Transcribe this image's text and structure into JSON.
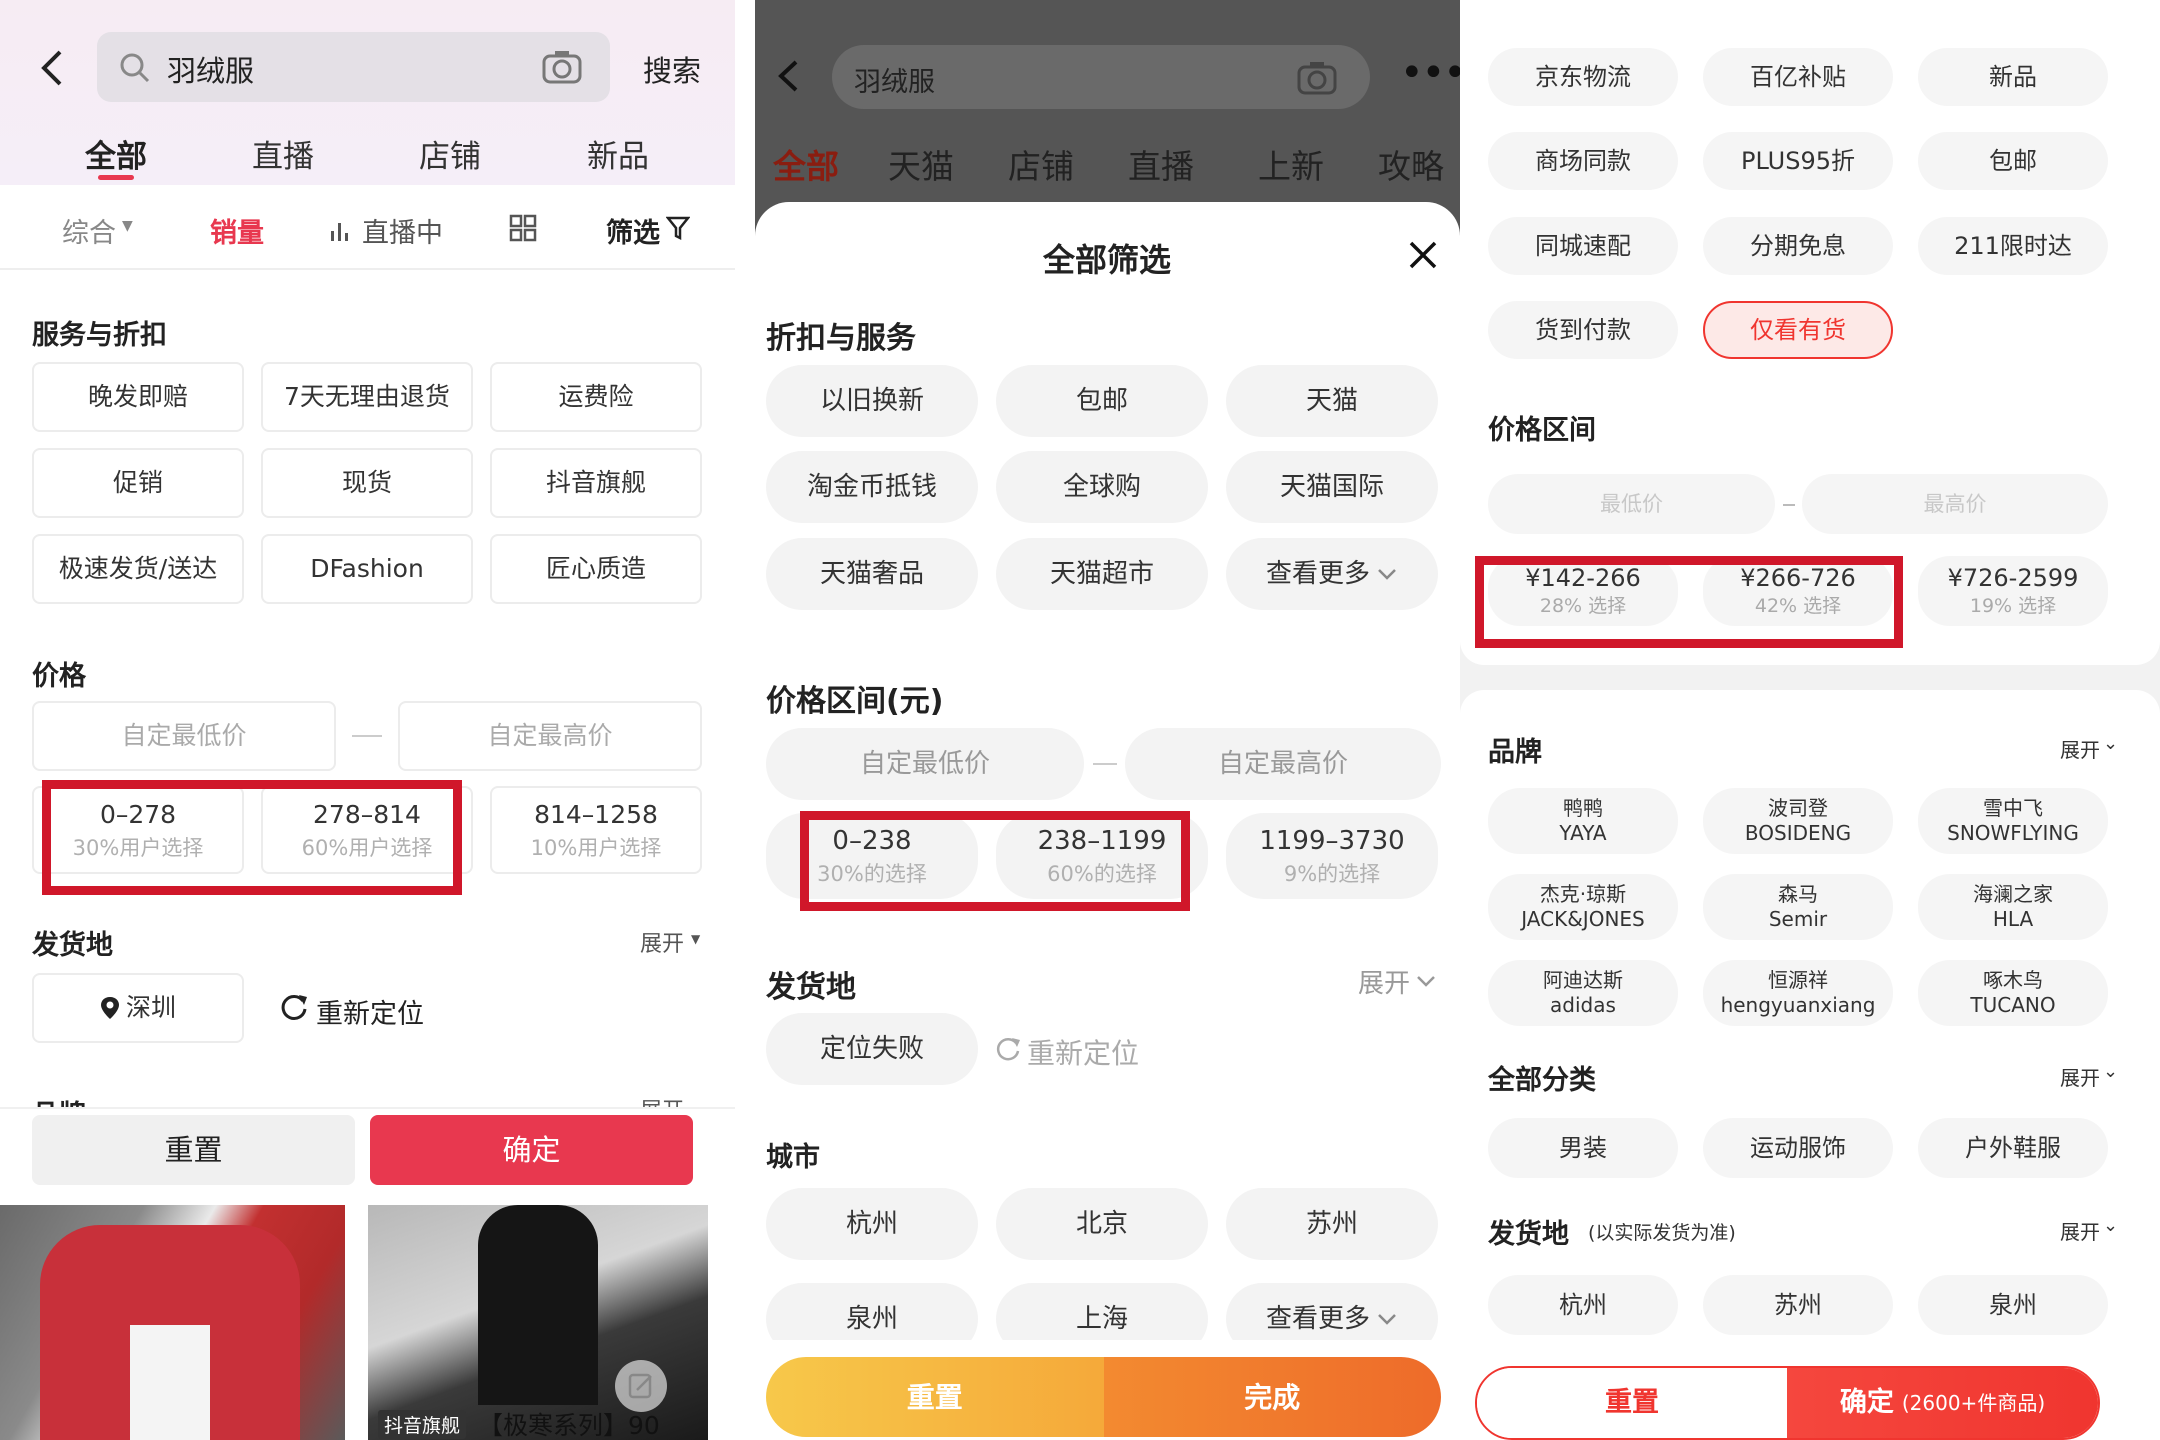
{
  "p1": {
    "search_value": "羽绒服",
    "search_button": "搜索",
    "tabs": [
      "全部",
      "直播",
      "店铺",
      "新品"
    ],
    "sort": {
      "comprehensive": "综合",
      "sales": "销量",
      "live": "直播中",
      "filter": "筛选"
    },
    "service_title": "服务与折扣",
    "service_chips": [
      "晚发即赔",
      "7天无理由退货",
      "运费险",
      "促销",
      "现货",
      "抖音旗舰",
      "极速发货/送达",
      "DFashion",
      "匠心质造"
    ],
    "price_title": "价格",
    "min_placeholder": "自定最低价",
    "max_placeholder": "自定最高价",
    "ranges": [
      {
        "range": "0–278",
        "pct": "30%用户选择"
      },
      {
        "range": "278–814",
        "pct": "60%用户选择"
      },
      {
        "range": "814–1258",
        "pct": "10%用户选择"
      }
    ],
    "ship_title": "发货地",
    "expand": "展开",
    "location": "深圳",
    "relocate": "重新定位",
    "brand_title": "品牌",
    "reset": "重置",
    "confirm": "确定",
    "product_tag": "抖音旗舰",
    "product_title": "【极寒系列】90"
  },
  "p2": {
    "search_value": "羽绒服",
    "tabs": [
      "全部",
      "天猫",
      "店铺",
      "直播",
      "上新",
      "攻略"
    ],
    "sheet_title": "全部筛选",
    "service_title": "折扣与服务",
    "service_chips": [
      "以旧换新",
      "包邮",
      "天猫",
      "淘金币抵钱",
      "全球购",
      "天猫国际",
      "天猫奢品",
      "天猫超市",
      "查看更多"
    ],
    "price_title": "价格区间(元)",
    "min_placeholder": "自定最低价",
    "max_placeholder": "自定最高价",
    "ranges": [
      {
        "range": "0–238",
        "pct": "30%的选择"
      },
      {
        "range": "238–1199",
        "pct": "60%的选择"
      },
      {
        "range": "1199–3730",
        "pct": "9%的选择"
      }
    ],
    "ship_title": "发货地",
    "expand": "展开",
    "location_failed": "定位失败",
    "relocate": "重新定位",
    "city_title": "城市",
    "cities": [
      "杭州",
      "北京",
      "苏州",
      "泉州",
      "上海",
      "查看更多"
    ],
    "reset": "重置",
    "done": "完成"
  },
  "p3": {
    "service_chips": [
      "京东物流",
      "百亿补贴",
      "新品",
      "商场同款",
      "PLUS95折",
      "包邮",
      "同城速配",
      "分期免息",
      "211限时达",
      "货到付款",
      "仅看有货"
    ],
    "price_title": "价格区间",
    "min_placeholder": "最低价",
    "max_placeholder": "最高价",
    "ranges": [
      {
        "range": "¥142-266",
        "pct": "28% 选择"
      },
      {
        "range": "¥266-726",
        "pct": "42% 选择"
      },
      {
        "range": "¥726-2599",
        "pct": "19% 选择"
      }
    ],
    "brand_title": "品牌",
    "expand": "展开",
    "brands": [
      {
        "cn": "鸭鸭",
        "en": "YAYA"
      },
      {
        "cn": "波司登",
        "en": "BOSIDENG"
      },
      {
        "cn": "雪中飞",
        "en": "SNOWFLYING"
      },
      {
        "cn": "杰克·琼斯",
        "en": "JACK&JONES"
      },
      {
        "cn": "森马",
        "en": "Semir"
      },
      {
        "cn": "海澜之家",
        "en": "HLA"
      },
      {
        "cn": "阿迪达斯",
        "en": "adidas"
      },
      {
        "cn": "恒源祥",
        "en": "hengyuanxiang"
      },
      {
        "cn": "啄木鸟",
        "en": "TUCANO"
      }
    ],
    "category_title": "全部分类",
    "categories": [
      "男装",
      "运动服饰",
      "户外鞋服"
    ],
    "ship_title": "发货地",
    "ship_note": "(以实际发货为准)",
    "cities": [
      "杭州",
      "苏州",
      "泉州"
    ],
    "reset": "重置",
    "confirm": "确定",
    "confirm_count": "(2600+件商品)"
  },
  "colors": {
    "accent_red": "#e8384f",
    "highlight_box": "#d0172a",
    "orange_start": "#f7c14a",
    "orange_end": "#ee6b2a",
    "jd_red": "#f0352f"
  }
}
